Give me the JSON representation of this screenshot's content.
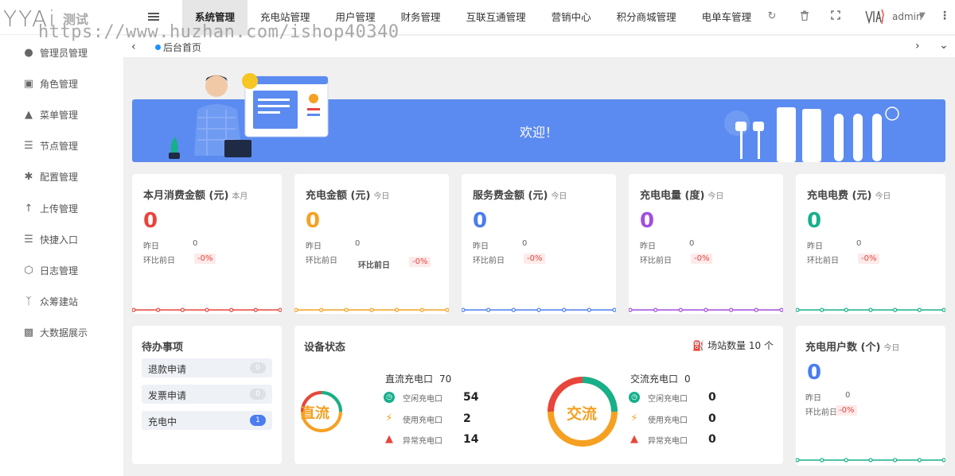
{
  "brand": {
    "logo_text": "YYAi",
    "test_label": "测试"
  },
  "watermark": "https://www.huzhan.com/ishop40340",
  "top_tabs": [
    {
      "label": "系统管理",
      "active": true
    },
    {
      "label": "充电站管理"
    },
    {
      "label": "用户管理"
    },
    {
      "label": "财务管理"
    },
    {
      "label": "互联互通管理"
    },
    {
      "label": "营销中心"
    },
    {
      "label": "积分商城管理"
    },
    {
      "label": "电单车管理"
    }
  ],
  "user": {
    "name": "admin"
  },
  "sidebar": {
    "items": [
      {
        "label": "管理员管理",
        "icon": "user-icon"
      },
      {
        "label": "角色管理",
        "icon": "role-icon"
      },
      {
        "label": "菜单管理",
        "icon": "tree-icon"
      },
      {
        "label": "节点管理",
        "icon": "list-icon"
      },
      {
        "label": "配置管理",
        "icon": "asterisk-icon"
      },
      {
        "label": "上传管理",
        "icon": "upload-arrow-icon"
      },
      {
        "label": "快捷入口",
        "icon": "list-icon"
      },
      {
        "label": "日志管理",
        "icon": "log-icon"
      },
      {
        "label": "众筹建站",
        "icon": "branch-icon"
      },
      {
        "label": "大数据展示",
        "icon": "bar-chart-icon"
      }
    ]
  },
  "breadcrumb": {
    "home": "后台首页"
  },
  "banner": {
    "welcome": "欢迎！"
  },
  "stats": [
    {
      "title": "本月消费金额 (元)",
      "period": "本月",
      "value": "0",
      "color": "#e8453c",
      "yesterday_label": "昨日",
      "yesterday_value": "0",
      "compare_label": "环比前日",
      "compare_value": "-0%"
    },
    {
      "title": "充电金额 (元)",
      "period": "今日",
      "value": "0",
      "color": "#f6a022",
      "yesterday_label": "昨日",
      "yesterday_value": "0",
      "compare_label": "环比前日",
      "compare_value": "-0%",
      "compare_extra": "环比前日"
    },
    {
      "title": "服务费金额 (元)",
      "period": "今日",
      "value": "0",
      "color": "#4a7df0",
      "yesterday_label": "昨日",
      "yesterday_value": "0",
      "compare_label": "环比前日",
      "compare_value": "-0%"
    },
    {
      "title": "充电电量 (度)",
      "period": "今日",
      "value": "0",
      "color": "#a24de0",
      "yesterday_label": "昨日",
      "yesterday_value": "0",
      "compare_label": "环比前日",
      "compare_value": "-0%"
    },
    {
      "title": "充电电费 (元)",
      "period": "今日",
      "value": "0",
      "color": "#16b08a",
      "yesterday_label": "昨日",
      "yesterday_value": "0",
      "compare_label": "环比前日",
      "compare_value": "-0%"
    }
  ],
  "todo": {
    "title": "待办事项",
    "items": [
      {
        "label": "退款申请",
        "count": "0",
        "highlight": false
      },
      {
        "label": "发票申请",
        "count": "0",
        "highlight": false
      },
      {
        "label": "充电中",
        "count": "1",
        "highlight": true
      }
    ]
  },
  "devices": {
    "title": "设备状态",
    "station_count_label": "场站数量 10 个",
    "dc": {
      "ring_label": "直流",
      "header_label": "直流充电口",
      "header_value": "70",
      "rows": [
        {
          "label": "空闲充电口",
          "value": "54",
          "icon": "clock-icon",
          "color": "#16b08a"
        },
        {
          "label": "使用充电口",
          "value": "2",
          "icon": "bolt-icon",
          "color": "#f6a022"
        },
        {
          "label": "异常充电口",
          "value": "14",
          "icon": "warning-icon",
          "color": "#e8453c"
        }
      ]
    },
    "ac": {
      "ring_label": "交流",
      "header_label": "交流充电口",
      "header_value": "0",
      "rows": [
        {
          "label": "空闲充电口",
          "value": "0",
          "icon": "clock-icon",
          "color": "#16b08a"
        },
        {
          "label": "使用充电口",
          "value": "0",
          "icon": "bolt-icon",
          "color": "#f6a022"
        },
        {
          "label": "异常充电口",
          "value": "0",
          "icon": "warning-icon",
          "color": "#e8453c"
        }
      ]
    }
  },
  "users_card": {
    "title": "充电用户数 (个)",
    "period": "今日",
    "value": "0",
    "yesterday_label": "昨日",
    "yesterday_value": "0",
    "compare_label": "环比前日",
    "compare_value": "-0%",
    "color": "#4a7df0"
  }
}
